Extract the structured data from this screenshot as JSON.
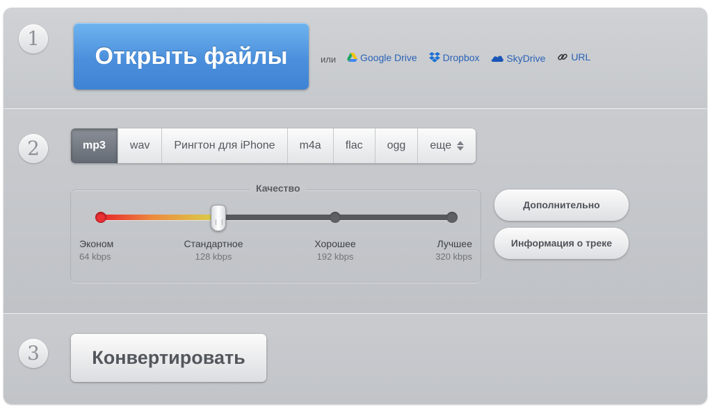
{
  "step1": {
    "number": "1",
    "open_button": "Открыть файлы",
    "or_label": "или",
    "sources": [
      {
        "label": "Google Drive",
        "icon": "google-drive-icon"
      },
      {
        "label": "Dropbox",
        "icon": "dropbox-icon"
      },
      {
        "label": "SkyDrive",
        "icon": "skydrive-icon"
      },
      {
        "label": "URL",
        "icon": "link-icon"
      }
    ]
  },
  "step2": {
    "number": "2",
    "formats": [
      "mp3",
      "wav",
      "Рингтон для iPhone",
      "m4a",
      "flac",
      "ogg",
      "еще"
    ],
    "active_format": "mp3",
    "quality": {
      "title": "Качество",
      "selected_level": 2,
      "levels": [
        {
          "name": "Эконом",
          "rate": "64 kbps"
        },
        {
          "name": "Стандартное",
          "rate": "128 kbps"
        },
        {
          "name": "Хорошее",
          "rate": "192 kbps"
        },
        {
          "name": "Лучшее",
          "rate": "320 kbps"
        }
      ]
    },
    "advanced_button": "Дополнительно",
    "track_info_button": "Информация о треке"
  },
  "step3": {
    "number": "3",
    "convert_button": "Конвертировать"
  },
  "colors": {
    "accent_blue": "#4b8fdc",
    "link_blue": "#2a62b6",
    "slider_red": "#e7252c",
    "slider_yellow": "#d8d24a"
  }
}
